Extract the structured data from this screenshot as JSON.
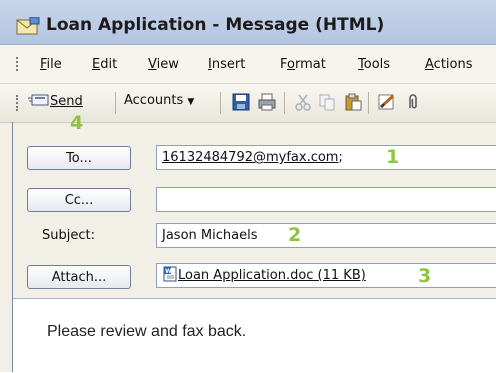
{
  "window": {
    "title": "Loan Application - Message (HTML)"
  },
  "menu": [
    "File",
    "Edit",
    "View",
    "Insert",
    "Format",
    "Tools",
    "Actions"
  ],
  "toolbar": {
    "send_label": "Send",
    "accounts_label": "Accounts"
  },
  "fields": {
    "to_button": "To...",
    "to_value": "16132484792@myfax.com",
    "to_suffix": ";",
    "cc_button": "Cc...",
    "cc_value": "",
    "subject_label": "Subject:",
    "subject_value": "Jason Michaels",
    "attach_button": "Attach...",
    "attachment_name": "Loan Application.doc (11 KB)"
  },
  "body": {
    "text": "Please review and fax back."
  },
  "callouts": {
    "to": "1",
    "subject": "2",
    "attach": "3",
    "send": "4"
  },
  "colors": {
    "callout": "#8cc63f",
    "titlebar": "#b3c5e2"
  }
}
